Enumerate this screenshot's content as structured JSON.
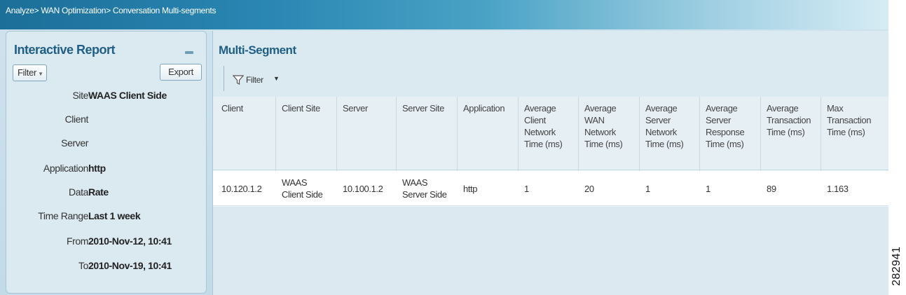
{
  "breadcrumb": "Analyze> WAN Optimization> Conversation Multi-segments",
  "left_panel": {
    "title": "Interactive Report",
    "filter_button": "Filter",
    "export_button": "Export",
    "fields": [
      {
        "key": "Site",
        "value": "WAAS Client Side"
      },
      {
        "key": "Client",
        "value": ""
      },
      {
        "key": "Server",
        "value": ""
      },
      {
        "key": "Application",
        "value": "http"
      },
      {
        "key": "Data",
        "value": "Rate"
      },
      {
        "key": "Time Range",
        "value": "Last 1 week"
      },
      {
        "key": "From",
        "value": "2010-Nov-12, 10:41"
      },
      {
        "key": "To",
        "value": "2010-Nov-19, 10:41"
      }
    ]
  },
  "main_panel": {
    "title": "Multi-Segment",
    "toolbar": {
      "filter_label": "Filter"
    },
    "columns": [
      [
        "Client"
      ],
      [
        "Client Site"
      ],
      [
        "Server"
      ],
      [
        "Server Site"
      ],
      [
        "Application"
      ],
      [
        "Average",
        "Client",
        "Network",
        "Time (ms)"
      ],
      [
        "Average",
        "WAN",
        "Network",
        "Time (ms)"
      ],
      [
        "Average",
        "Server",
        "Network",
        "Time (ms)"
      ],
      [
        "Average",
        "Server",
        "Response",
        "Time (ms)"
      ],
      [
        "Average",
        "Transaction",
        "Time (ms)"
      ],
      [
        "Max",
        "Transaction",
        "Time (ms)"
      ]
    ],
    "rows": [
      [
        [
          "10.120.1.2"
        ],
        [
          "WAAS",
          "Client Side"
        ],
        [
          "10.100.1.2"
        ],
        [
          "WAAS",
          "Server Side"
        ],
        [
          "http"
        ],
        [
          "1"
        ],
        [
          "20"
        ],
        [
          "1"
        ],
        [
          "1"
        ],
        [
          "89"
        ],
        [
          "1.163"
        ]
      ]
    ]
  },
  "figure_id": "282941",
  "colors": {
    "title_blue": "#1f5f86",
    "panel_bg": "#dbe9f1",
    "topbar": "#2a86b2"
  },
  "icons": {
    "filter_icon": "funnel-icon",
    "minimize_icon": "minimize-icon"
  }
}
